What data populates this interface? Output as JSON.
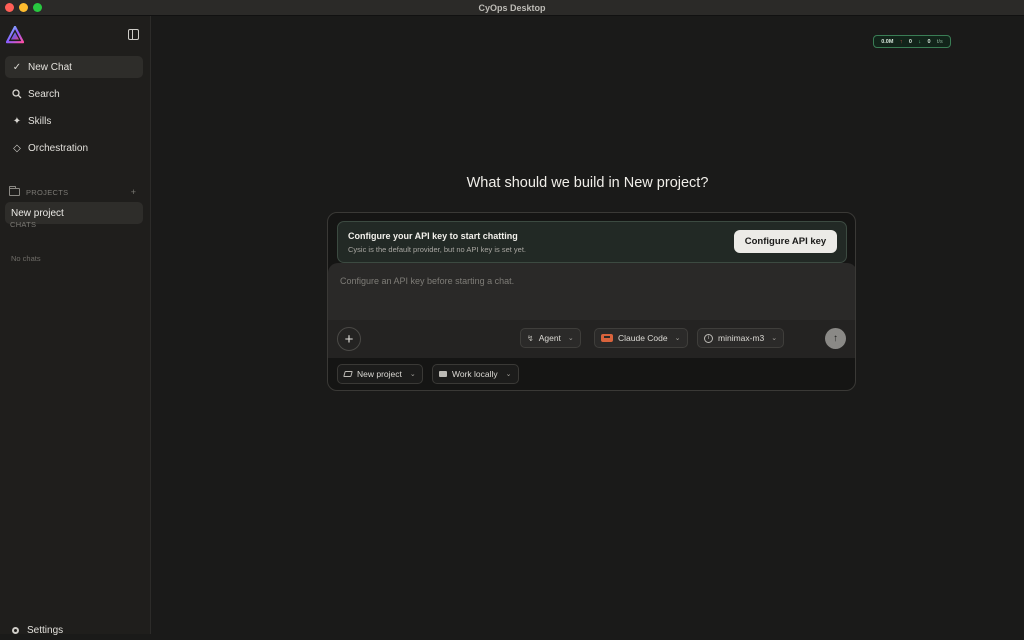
{
  "window": {
    "title": "CyOps Desktop"
  },
  "sidebar": {
    "nav": [
      {
        "label": "New Chat",
        "icon": "pencil-check-icon"
      },
      {
        "label": "Search",
        "icon": "search-icon"
      },
      {
        "label": "Skills",
        "icon": "sparkle-icon"
      },
      {
        "label": "Orchestration",
        "icon": "diamond-icon"
      }
    ],
    "projects_label": "PROJECTS",
    "projects_add": "+",
    "project_items": [
      {
        "label": "New project"
      }
    ],
    "chats_label": "CHATS",
    "chats_empty": "No chats",
    "settings_label": "Settings"
  },
  "stats": {
    "tokens": "0.0M",
    "up_value": "0",
    "down_value": "0",
    "rate_unit": "t/s",
    "up_color": "#e05a4f",
    "down_color": "#5fc98a"
  },
  "main": {
    "heading": "What should we build in New project?",
    "banner": {
      "title": "Configure your API key to start chatting",
      "subtitle": "Cysic is the default provider, but no API key is set yet.",
      "button": "Configure API key"
    },
    "input": {
      "placeholder": "Configure an API key before starting a chat.",
      "value": ""
    },
    "toolbar": {
      "mode": "Agent",
      "provider": "Claude Code",
      "model": "minimax-m3"
    },
    "footer": {
      "project": "New project",
      "location": "Work locally"
    }
  }
}
